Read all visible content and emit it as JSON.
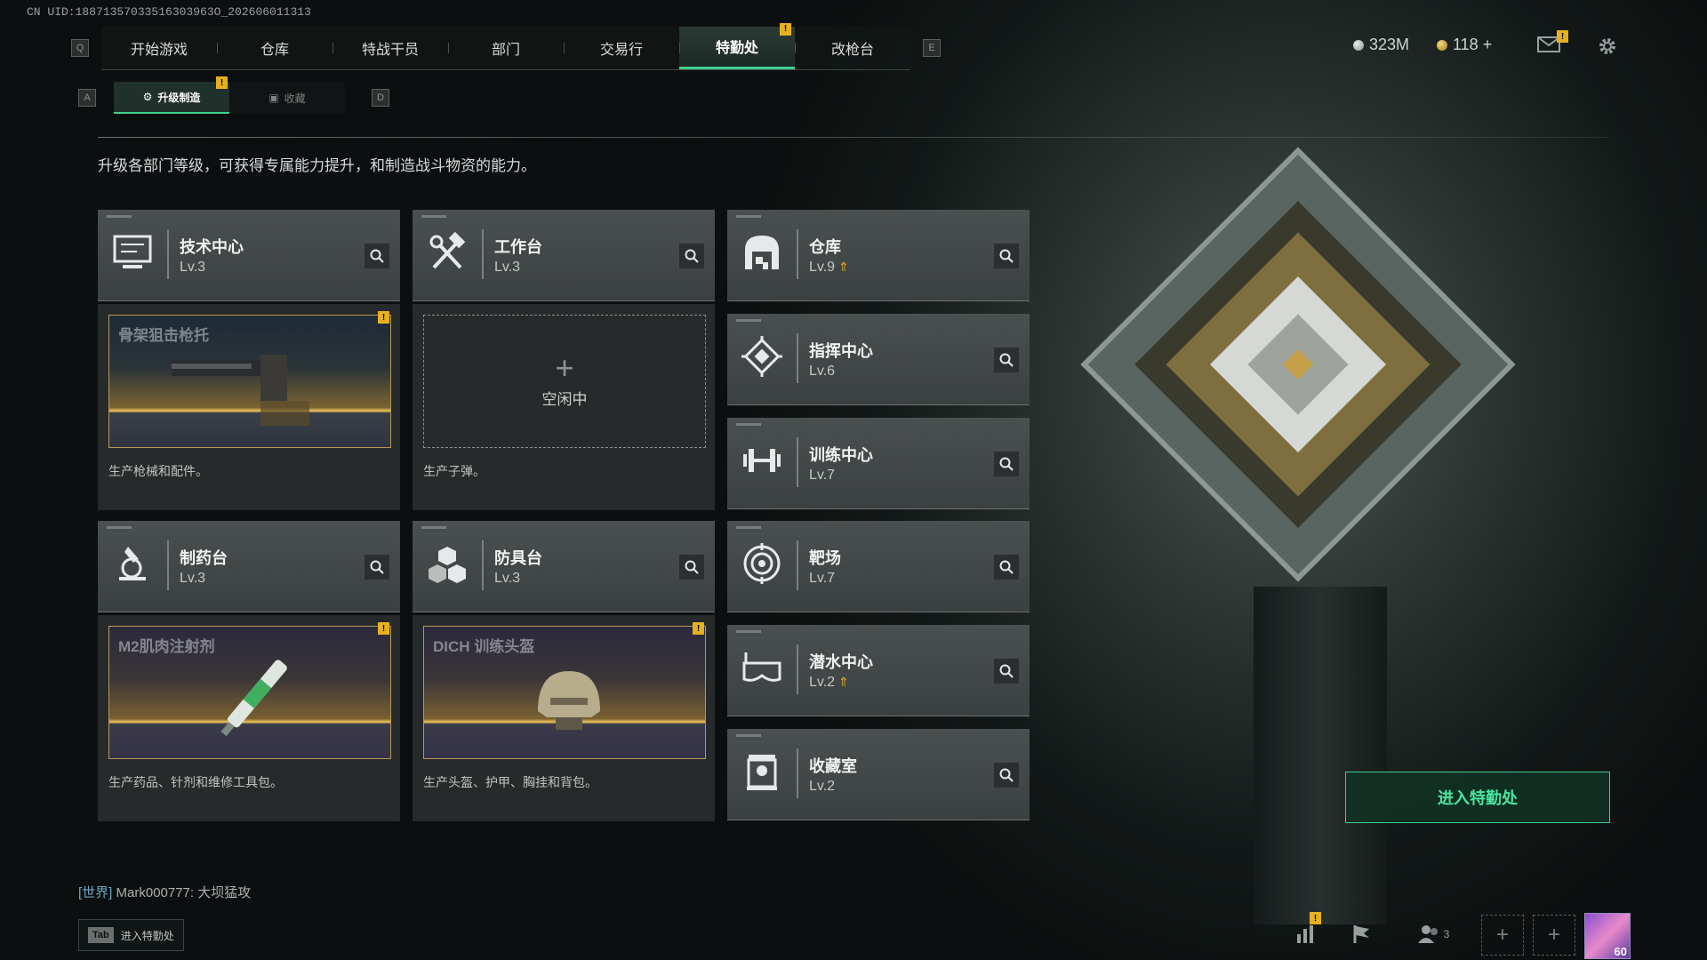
{
  "uid": "CN UID:18871357033516303963O_202606011313",
  "nav": {
    "left_key": "Q",
    "right_key": "E",
    "tabs": [
      "开始游戏",
      "仓库",
      "特战干员",
      "部门",
      "交易行",
      "特勤处",
      "改枪台"
    ],
    "active_tab": "特勤处",
    "badge": "!"
  },
  "currency": {
    "silver": "323M",
    "gold": "118 +"
  },
  "subnav": {
    "left_key": "A",
    "right_key": "D",
    "tabs": [
      "升级制造",
      "收藏"
    ],
    "active": "升级制造"
  },
  "description": "升级各部门等级，可获得专属能力提升，和制造战斗物资的能力。",
  "stations": {
    "tech": {
      "name": "技术中心",
      "level": "Lv.3",
      "icon": "monitor-icon"
    },
    "workbench": {
      "name": "工作台",
      "level": "Lv.3",
      "icon": "hammer-wrench-icon"
    },
    "pharmacy": {
      "name": "制药台",
      "level": "Lv.3",
      "icon": "microscope-icon"
    },
    "armor": {
      "name": "防具台",
      "level": "Lv.3",
      "icon": "cubes-icon"
    },
    "warehouse": {
      "name": "仓库",
      "level": "Lv.9",
      "icon": "warehouse-icon",
      "upgradable": true
    },
    "command": {
      "name": "指挥中心",
      "level": "Lv.6",
      "icon": "command-icon"
    },
    "training": {
      "name": "训练中心",
      "level": "Lv.7",
      "icon": "dumbbell-icon"
    },
    "range": {
      "name": "靶场",
      "level": "Lv.7",
      "icon": "target-icon"
    },
    "diving": {
      "name": "潜水中心",
      "level": "Lv.2",
      "icon": "goggles-icon",
      "upgradable": true
    },
    "collection": {
      "name": "收藏室",
      "level": "Lv.2",
      "icon": "trophy-icon"
    }
  },
  "productions": {
    "tech": {
      "item": "骨架狙击枪托",
      "desc": "生产枪械和配件。"
    },
    "workbench": {
      "status": "空闲中",
      "desc": "生产子弹。"
    },
    "pharmacy": {
      "item": "M2肌肉注射剂",
      "desc": "生产药品、针剂和维修工具包。"
    },
    "armor": {
      "item": "DICH 训练头盔",
      "desc": "生产头盔、护甲、胸挂和背包。"
    }
  },
  "enter_button": "进入特勤处",
  "chat": {
    "channel": "[世界]",
    "user": "Mark000777:",
    "message": "大坝猛攻"
  },
  "tab_hint": {
    "key": "Tab",
    "label": "进入特勤处"
  },
  "bottom": {
    "friends_count": "3",
    "level": "60"
  },
  "colors": {
    "accent": "#3fcf8e",
    "badge": "#e6b020"
  }
}
